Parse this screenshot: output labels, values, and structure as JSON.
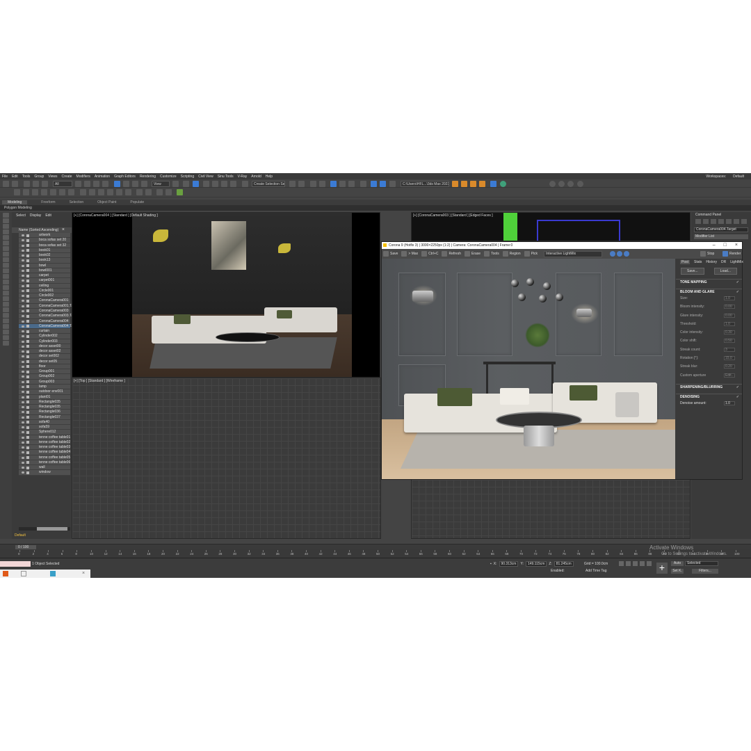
{
  "menu": [
    "File",
    "Edit",
    "Tools",
    "Group",
    "Views",
    "Create",
    "Modifiers",
    "Animation",
    "Graph Editors",
    "Rendering",
    "Customize",
    "Scripting",
    "Civil View",
    "Sinu Tools",
    "V-Ray",
    "Arnold",
    "Help"
  ],
  "workspace": {
    "label": "Workspaces:",
    "value": "Default"
  },
  "toolbar": {
    "filter": "All",
    "view": "View",
    "selection_set": "Create Selection Set",
    "path": "C:\\Users\\HFL...\\3ds Max 2023"
  },
  "ribbon": [
    "Modeling",
    "Freeform",
    "Selection",
    "Object Paint",
    "Populate"
  ],
  "polygon_modeling": "Polygon Modeling",
  "scene_explorer": {
    "tabs": [
      "Select",
      "Display",
      "Edit"
    ],
    "header": "Name (Sorted Ascending)",
    "items": [
      "artwork",
      "boca sofas set 20",
      "boca sofas set 32",
      "book01",
      "book02",
      "book13",
      "bowl",
      "bowl001",
      "carpet",
      "carpet001",
      "ceiling",
      "Circle001",
      "Circle002",
      "CoronaCamera001",
      "CoronaCamera001.Target",
      "CoronaCamera003",
      "CoronaCamera003.Target",
      "CoronaCamera004",
      "CoronaCamera004.Target",
      "curtain",
      "Cylinder002",
      "Cylinder003",
      "decor asset00",
      "decor asset02",
      "decor set002",
      "decor set05",
      "floor",
      "Group001",
      "Group002",
      "Group003",
      "lamp",
      "outdoor env001",
      "plant01",
      "Rectangle035",
      "Rectangle035",
      "Rectangle036",
      "Rectangle037",
      "sofa40",
      "sofa59",
      "Sphere012",
      "tenne coffee table01",
      "tenne coffee table02",
      "tenne coffee table03",
      "tenne coffee table04",
      "tenne coffee table05",
      "tenne coffee table06",
      "wall",
      "window"
    ],
    "selected_index": 18,
    "footer": "Default"
  },
  "viewports": {
    "tl": "[+] [CoronaCamera004 ] [Standard ] [Default Shading ]",
    "tr": "[+] [CoronaCamera003 ] [Standard ] [Edged Faces ]",
    "bl": "[+] [Top ] [Standard ] [Wireframe ]"
  },
  "command_panel": {
    "title": "Command Panel",
    "object": "CoronaCamera004.Target",
    "modifier_list": "Modifier List"
  },
  "corona": {
    "title": "Corona 9 (Hotfix 3) | 3000×2250px (1:2) | Camera: CoronaCamera004 | Frame:0",
    "tools": [
      "Save",
      "> Max",
      "Ctrl+C",
      "Refresh",
      "Erase",
      "Tools",
      "Region",
      "Pick"
    ],
    "interactive": "Interactive LightMix",
    "stop": "Stop",
    "render": "Render",
    "tabs": [
      "Post",
      "Stats",
      "History",
      "DR",
      "LightMix"
    ],
    "save": "Save...",
    "load": "Load...",
    "sections": [
      "TONE MAPPING",
      "BLOOM AND GLARE",
      "SHARPENING/BLURRING",
      "DENOISING"
    ],
    "bloom_props": [
      {
        "label": "Size:",
        "value": "1.0"
      },
      {
        "label": "Bloom intensity:",
        "value": "0.00"
      },
      {
        "label": "Glare intensity:",
        "value": "0.00"
      },
      {
        "label": "Threshold:",
        "value": "1.0"
      },
      {
        "label": "Color intensity:",
        "value": "0.30"
      },
      {
        "label": "Color shift:",
        "value": "0.50"
      },
      {
        "label": "Streak count:",
        "value": "3"
      },
      {
        "label": "Rotation [°]:",
        "value": "15.0"
      },
      {
        "label": "Streak blur:",
        "value": "0.20"
      },
      {
        "label": "Custom aperture",
        "value": "Edit..."
      }
    ],
    "denoise": {
      "label": "Denoise amount:",
      "value": "1.0"
    }
  },
  "timeline": {
    "frame": "0 / 100",
    "ticks": [
      "0",
      "2",
      "4",
      "6",
      "8",
      "10",
      "12",
      "14",
      "16",
      "18",
      "20",
      "22",
      "24",
      "26",
      "28",
      "30",
      "32",
      "34",
      "36",
      "38",
      "40",
      "42",
      "44",
      "46",
      "48",
      "50",
      "52",
      "54",
      "56",
      "58",
      "60",
      "62",
      "64",
      "66",
      "68",
      "70",
      "72",
      "74",
      "76",
      "78",
      "80",
      "82",
      "84",
      "86",
      "88",
      "90",
      "92",
      "94",
      "96",
      "98",
      "100"
    ]
  },
  "status": {
    "message": "1 Object Selected",
    "x_label": "X:",
    "x": "90.313cm",
    "y_label": "Y:",
    "y": "149.115cm",
    "z_label": "Z:",
    "z": "81.245cm",
    "grid": "Grid = 100.0cm",
    "enabled": "Enabled:",
    "add_time_tag": "Add Time Tag",
    "auto": "Auto",
    "set_k": "Set K.",
    "selected": "Selected",
    "filters": "Filters..."
  },
  "watermark": {
    "line1": "Activate Windows",
    "line2": "Go to Settings to activate Windows."
  }
}
